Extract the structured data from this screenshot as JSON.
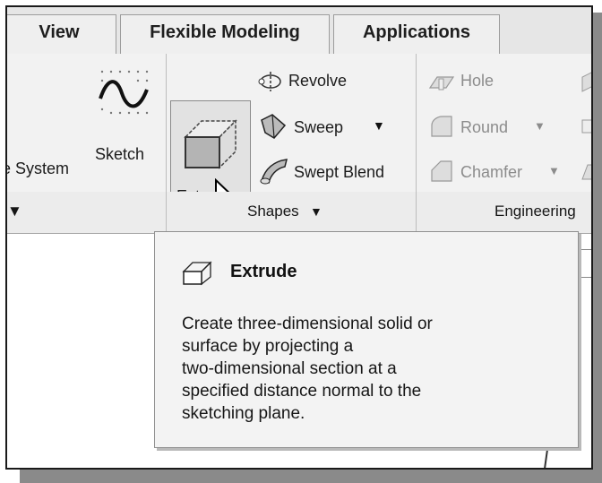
{
  "tabs": [
    {
      "label": "View"
    },
    {
      "label": "Flexible Modeling"
    },
    {
      "label": "Applications"
    }
  ],
  "ribbon": {
    "partial_left_label": "e System",
    "sketch_label": "Sketch",
    "extrude_label": "Extrude",
    "revolve_label": "Revolve",
    "sweep_label": "Sweep",
    "swept_blend_label": "Swept Blend",
    "hole_label": "Hole",
    "round_label": "Round",
    "chamfer_label": "Chamfer"
  },
  "groups": {
    "shapes_label": "Shapes",
    "engineering_label": "Engineering"
  },
  "tooltip": {
    "title": "Extrude",
    "body": "Create three-dimensional solid or\nsurface by projecting a\ntwo-dimensional section at a\nspecified distance normal to the\nsketching plane."
  },
  "icons": {
    "sketch": "sketch-icon",
    "extrude": "extrude-icon",
    "revolve": "revolve-icon",
    "sweep": "sweep-icon",
    "swept_blend": "swept-blend-icon",
    "hole": "hole-icon",
    "round": "round-icon",
    "chamfer": "chamfer-icon",
    "cursor": "mouse-cursor-icon"
  }
}
